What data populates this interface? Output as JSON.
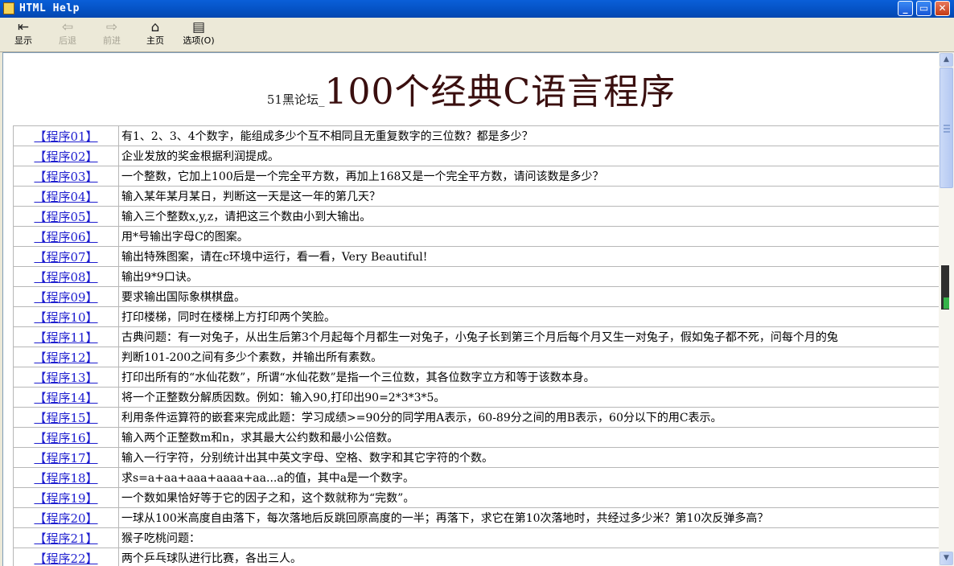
{
  "window": {
    "title": "HTML Help"
  },
  "toolbar": {
    "show_label": "显示",
    "back_label": "后退",
    "forward_label": "前进",
    "home_label": "主页",
    "options_label": "选项(O)"
  },
  "page": {
    "subtitle": "51黑论坛_",
    "title": "100个经典C语言程序"
  },
  "programs": [
    {
      "link": "【程序01】",
      "desc": "有1、2、3、4个数字，能组成多少个互不相同且无重复数字的三位数？都是多少？"
    },
    {
      "link": "【程序02】",
      "desc": "企业发放的奖金根据利润提成。"
    },
    {
      "link": "【程序03】",
      "desc": "一个整数，它加上100后是一个完全平方数，再加上168又是一个完全平方数，请问该数是多少？"
    },
    {
      "link": "【程序04】",
      "desc": "输入某年某月某日，判断这一天是这一年的第几天？"
    },
    {
      "link": "【程序05】",
      "desc": "输入三个整数x,y,z，请把这三个数由小到大输出。"
    },
    {
      "link": "【程序06】",
      "desc": "用*号输出字母C的图案。"
    },
    {
      "link": "【程序07】",
      "desc": "输出特殊图案，请在c环境中运行，看一看，Very Beautiful!"
    },
    {
      "link": "【程序08】",
      "desc": "输出9*9口诀。"
    },
    {
      "link": "【程序09】",
      "desc": "要求输出国际象棋棋盘。"
    },
    {
      "link": "【程序10】",
      "desc": "打印楼梯，同时在楼梯上方打印两个笑脸。"
    },
    {
      "link": "【程序11】",
      "desc": "古典问题：有一对兔子，从出生后第3个月起每个月都生一对兔子，小兔子长到第三个月后每个月又生一对兔子，假如兔子都不死，问每个月的兔"
    },
    {
      "link": "【程序12】",
      "desc": "判断101-200之间有多少个素数，并输出所有素数。"
    },
    {
      "link": "【程序13】",
      "desc": "打印出所有的“水仙花数”，所谓“水仙花数”是指一个三位数，其各位数字立方和等于该数本身。"
    },
    {
      "link": "【程序14】",
      "desc": "将一个正整数分解质因数。例如：输入90,打印出90=2*3*3*5。"
    },
    {
      "link": "【程序15】",
      "desc": "利用条件运算符的嵌套来完成此题：学习成绩>=90分的同学用A表示，60-89分之间的用B表示，60分以下的用C表示。"
    },
    {
      "link": "【程序16】",
      "desc": "输入两个正整数m和n，求其最大公约数和最小公倍数。"
    },
    {
      "link": "【程序17】",
      "desc": "输入一行字符，分别统计出其中英文字母、空格、数字和其它字符的个数。"
    },
    {
      "link": "【程序18】",
      "desc": "求s=a+aa+aaa+aaaa+aa...a的值，其中a是一个数字。"
    },
    {
      "link": "【程序19】",
      "desc": "一个数如果恰好等于它的因子之和，这个数就称为“完数”。"
    },
    {
      "link": "【程序20】",
      "desc": "一球从100米高度自由落下，每次落地后反跳回原高度的一半；再落下，求它在第10次落地时，共经过多少米？第10次反弹多高？"
    },
    {
      "link": "【程序21】",
      "desc": "猴子吃桃问题："
    },
    {
      "link": "【程序22】",
      "desc": "两个乒乓球队进行比赛，各出三人。"
    }
  ]
}
